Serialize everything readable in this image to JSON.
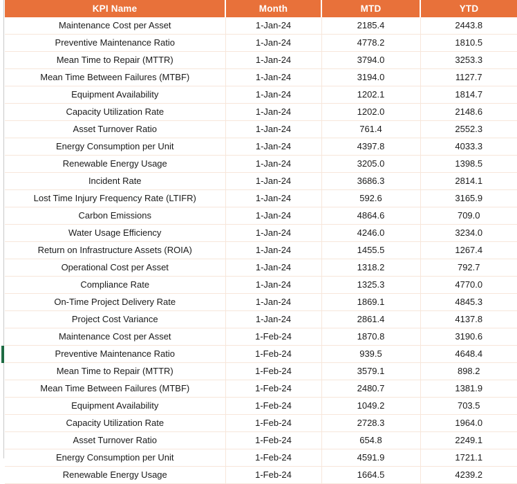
{
  "table": {
    "columns": [
      {
        "key": "kpi",
        "label": "KPI Name",
        "align": "center"
      },
      {
        "key": "month",
        "label": "Month",
        "align": "center"
      },
      {
        "key": "mtd",
        "label": "MTD",
        "align": "center"
      },
      {
        "key": "ytd",
        "label": "YTD",
        "align": "center"
      }
    ],
    "header_background": "#E8713A",
    "header_text_color": "#FFFFFF",
    "grid_line_color": "#F7E6DA",
    "row_marker": {
      "color": "#1E6B43",
      "row_index": 20,
      "kpi": "Preventive Maintenance Ratio",
      "month": "1-Feb-24"
    },
    "rows": [
      {
        "kpi": "Maintenance Cost per Asset",
        "month": "1-Jan-24",
        "mtd": "2185.4",
        "ytd": "2443.8"
      },
      {
        "kpi": "Preventive Maintenance Ratio",
        "month": "1-Jan-24",
        "mtd": "4778.2",
        "ytd": "1810.5"
      },
      {
        "kpi": "Mean Time to Repair (MTTR)",
        "month": "1-Jan-24",
        "mtd": "3794.0",
        "ytd": "3253.3"
      },
      {
        "kpi": "Mean Time Between Failures (MTBF)",
        "month": "1-Jan-24",
        "mtd": "3194.0",
        "ytd": "1127.7"
      },
      {
        "kpi": "Equipment Availability",
        "month": "1-Jan-24",
        "mtd": "1202.1",
        "ytd": "1814.7"
      },
      {
        "kpi": "Capacity Utilization Rate",
        "month": "1-Jan-24",
        "mtd": "1202.0",
        "ytd": "2148.6"
      },
      {
        "kpi": "Asset Turnover Ratio",
        "month": "1-Jan-24",
        "mtd": "761.4",
        "ytd": "2552.3"
      },
      {
        "kpi": "Energy Consumption per Unit",
        "month": "1-Jan-24",
        "mtd": "4397.8",
        "ytd": "4033.3"
      },
      {
        "kpi": "Renewable Energy Usage",
        "month": "1-Jan-24",
        "mtd": "3205.0",
        "ytd": "1398.5"
      },
      {
        "kpi": "Incident Rate",
        "month": "1-Jan-24",
        "mtd": "3686.3",
        "ytd": "2814.1"
      },
      {
        "kpi": "Lost Time Injury Frequency Rate (LTIFR)",
        "month": "1-Jan-24",
        "mtd": "592.6",
        "ytd": "3165.9"
      },
      {
        "kpi": "Carbon Emissions",
        "month": "1-Jan-24",
        "mtd": "4864.6",
        "ytd": "709.0"
      },
      {
        "kpi": "Water Usage Efficiency",
        "month": "1-Jan-24",
        "mtd": "4246.0",
        "ytd": "3234.0"
      },
      {
        "kpi": "Return on Infrastructure Assets (ROIA)",
        "month": "1-Jan-24",
        "mtd": "1455.5",
        "ytd": "1267.4"
      },
      {
        "kpi": "Operational Cost per Asset",
        "month": "1-Jan-24",
        "mtd": "1318.2",
        "ytd": "792.7"
      },
      {
        "kpi": "Compliance Rate",
        "month": "1-Jan-24",
        "mtd": "1325.3",
        "ytd": "4770.0"
      },
      {
        "kpi": "On-Time Project Delivery Rate",
        "month": "1-Jan-24",
        "mtd": "1869.1",
        "ytd": "4845.3"
      },
      {
        "kpi": "Project Cost Variance",
        "month": "1-Jan-24",
        "mtd": "2861.4",
        "ytd": "4137.8"
      },
      {
        "kpi": "Maintenance Cost per Asset",
        "month": "1-Feb-24",
        "mtd": "1870.8",
        "ytd": "3190.6"
      },
      {
        "kpi": "Preventive Maintenance Ratio",
        "month": "1-Feb-24",
        "mtd": "939.5",
        "ytd": "4648.4"
      },
      {
        "kpi": "Mean Time to Repair (MTTR)",
        "month": "1-Feb-24",
        "mtd": "3579.1",
        "ytd": "898.2"
      },
      {
        "kpi": "Mean Time Between Failures (MTBF)",
        "month": "1-Feb-24",
        "mtd": "2480.7",
        "ytd": "1381.9"
      },
      {
        "kpi": "Equipment Availability",
        "month": "1-Feb-24",
        "mtd": "1049.2",
        "ytd": "703.5"
      },
      {
        "kpi": "Capacity Utilization Rate",
        "month": "1-Feb-24",
        "mtd": "2728.3",
        "ytd": "1964.0"
      },
      {
        "kpi": "Asset Turnover Ratio",
        "month": "1-Feb-24",
        "mtd": "654.8",
        "ytd": "2249.1"
      },
      {
        "kpi": "Energy Consumption per Unit",
        "month": "1-Feb-24",
        "mtd": "4591.9",
        "ytd": "1721.1"
      },
      {
        "kpi": "Renewable Energy Usage",
        "month": "1-Feb-24",
        "mtd": "1664.5",
        "ytd": "4239.2"
      }
    ]
  }
}
